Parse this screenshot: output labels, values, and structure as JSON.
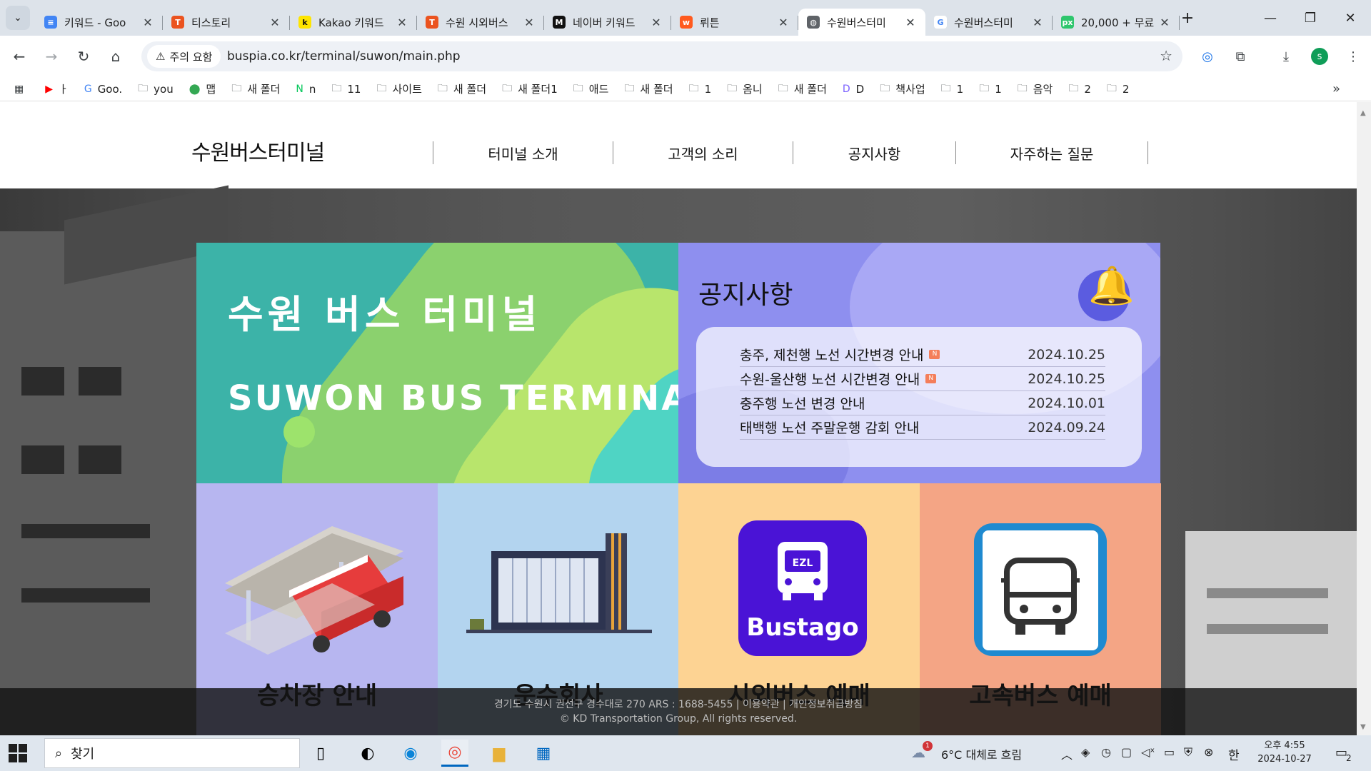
{
  "browser": {
    "tabs": [
      {
        "title": "키워드 - Goo",
        "icon": "docs-icon",
        "color": "#4285f4",
        "glyph": "≡"
      },
      {
        "title": "티스토리",
        "icon": "tistory-icon",
        "color": "#eb531f",
        "glyph": "T"
      },
      {
        "title": "Kakao 키워드",
        "icon": "kakao-icon",
        "color": "#fee500",
        "glyph": "k"
      },
      {
        "title": "수원 시외버스",
        "icon": "tistory-icon",
        "color": "#eb531f",
        "glyph": "T"
      },
      {
        "title": "네이버 키워드",
        "icon": "m-icon",
        "color": "#111111",
        "glyph": "M"
      },
      {
        "title": "뤼튼",
        "icon": "wrtn-icon",
        "color": "#ff5a1f",
        "glyph": "w"
      },
      {
        "title": "수원버스터미",
        "icon": "globe-icon",
        "color": "#5f6368",
        "glyph": "◍"
      },
      {
        "title": "수원버스터미",
        "icon": "google-icon",
        "color": "#ffffff",
        "glyph": "G"
      },
      {
        "title": "20,000 + 무료",
        "icon": "pixabay-icon",
        "color": "#2ec66d",
        "glyph": "px"
      }
    ],
    "active_tab": 6,
    "security_label": "주의 요함",
    "url": "buspia.co.kr/terminal/suwon/main.php",
    "bookmarks": [
      {
        "label": "",
        "icon": "apps-grid-icon"
      },
      {
        "label": "ㅏ",
        "icon": "youtube-icon"
      },
      {
        "label": "Goo.",
        "icon": "google-icon"
      },
      {
        "label": "you",
        "icon": "folder-icon"
      },
      {
        "label": "맵",
        "icon": "map-pin-icon"
      },
      {
        "label": "새 폴더",
        "icon": "folder-icon"
      },
      {
        "label": "n",
        "icon": "naver-icon"
      },
      {
        "label": "11",
        "icon": "folder-icon"
      },
      {
        "label": "사이트",
        "icon": "folder-icon"
      },
      {
        "label": "새 폴더",
        "icon": "folder-icon"
      },
      {
        "label": "새 폴더1",
        "icon": "folder-icon"
      },
      {
        "label": "애드",
        "icon": "folder-icon"
      },
      {
        "label": "새 폴더",
        "icon": "folder-icon"
      },
      {
        "label": "1",
        "icon": "folder-icon"
      },
      {
        "label": "옴니",
        "icon": "folder-icon"
      },
      {
        "label": "새 폴더",
        "icon": "folder-icon"
      },
      {
        "label": "D",
        "icon": "d-icon"
      },
      {
        "label": "책사업",
        "icon": "folder-icon"
      },
      {
        "label": "1",
        "icon": "folder-icon"
      },
      {
        "label": "1",
        "icon": "folder-icon"
      },
      {
        "label": "음악",
        "icon": "folder-icon"
      },
      {
        "label": "2",
        "icon": "folder-icon"
      },
      {
        "label": "2",
        "icon": "folder-icon"
      }
    ],
    "profile_initial": "s"
  },
  "site": {
    "logo": "수원버스터미널",
    "nav": [
      "터미널 소개",
      "고객의 소리",
      "공지사항",
      "자주하는 질문"
    ],
    "hero": {
      "title_kr": "수원 버스 터미널",
      "title_en": "SUWON BUS TERMINAL"
    },
    "notice": {
      "title": "공지사항",
      "new_badge": "N",
      "items": [
        {
          "title": "충주, 제천행 노선 시간변경 안내",
          "date": "2024.10.25",
          "new": true
        },
        {
          "title": "수원-울산행 노선 시간변경 안내",
          "date": "2024.10.25",
          "new": true
        },
        {
          "title": "충주행 노선 변경 안내",
          "date": "2024.10.01",
          "new": false
        },
        {
          "title": "태백행 노선 주말운행 감회 안내",
          "date": "2024.09.24",
          "new": false
        }
      ]
    },
    "tiles": [
      {
        "label": "승차장 안내",
        "color": "#b7b6f0"
      },
      {
        "label": "운수회사",
        "color": "#b3d4ef"
      },
      {
        "label": "시외버스 예매",
        "color": "#fdd393",
        "app_text": "Bustago"
      },
      {
        "label": "고속버스 예매",
        "color": "#f4a585"
      }
    ],
    "footer": {
      "line1": "경기도 수원시 권선구 경수대로 270 ARS : 1688-5455 | 이용약관 | 개인정보취급방침",
      "line2": "© KD Transportation Group, All rights reserved."
    }
  },
  "taskbar": {
    "search_label": "찾기",
    "weather": "6°C  대체로 흐림",
    "weather_badge": "1",
    "ime": "한",
    "clock_time": "오후 4:55",
    "clock_date": "2024-10-27",
    "notifications": "2"
  }
}
